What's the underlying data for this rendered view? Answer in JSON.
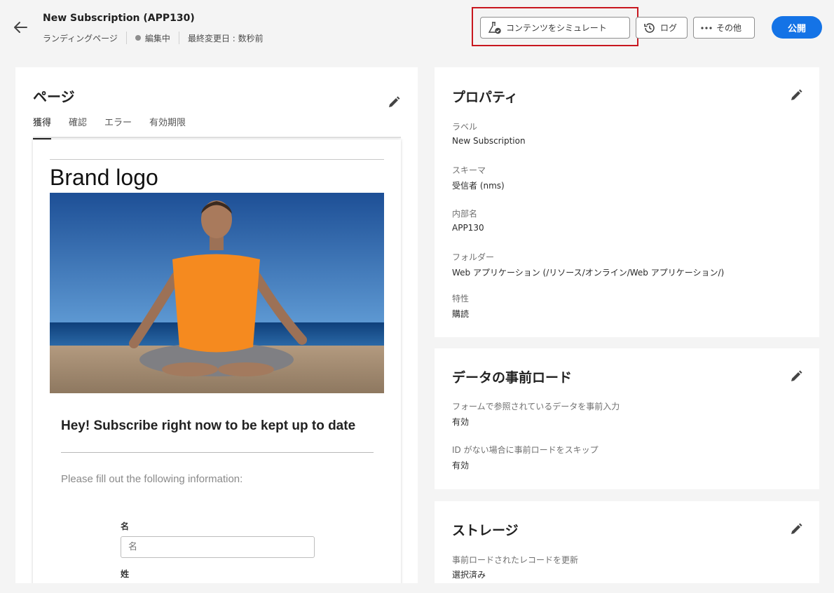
{
  "header": {
    "title": "New Subscription (APP130)",
    "type": "ランディングページ",
    "status": "編集中",
    "last_modified": "最終変更日 : 数秒前",
    "simulate_label": "コンテンツをシミュレート",
    "log_label": "ログ",
    "more_label": "その他",
    "publish_label": "公開"
  },
  "page_panel": {
    "title": "ページ",
    "tabs": [
      "獲得",
      "確認",
      "エラー",
      "有効期限"
    ],
    "active_tab": 0
  },
  "preview": {
    "brand_logo": "Brand logo",
    "headline": "Hey! Subscribe right now to be kept up to date",
    "instructions": "Please fill out the following information:",
    "first_name_label": "名",
    "first_name_placeholder": "名",
    "last_name_label": "姓"
  },
  "properties": {
    "title": "プロパティ",
    "fields": [
      {
        "label": "ラベル",
        "value": "New Subscription"
      },
      {
        "label": "スキーマ",
        "value": "受信者 (nms)"
      },
      {
        "label": "内部名",
        "value": "APP130"
      },
      {
        "label": "フォルダー",
        "value": "Web アプリケーション (/リソース/オンライン/Web アプリケーション/)"
      },
      {
        "label": "特性",
        "value": "購読"
      }
    ]
  },
  "preload": {
    "title": "データの事前ロード",
    "fields": [
      {
        "label": "フォームで参照されているデータを事前入力",
        "value": "有効"
      },
      {
        "label": "ID がない場合に事前ロードをスキップ",
        "value": "有効"
      }
    ]
  },
  "storage": {
    "title": "ストレージ",
    "fields": [
      {
        "label": "事前ロードされたレコードを更新",
        "value": "選択済み"
      }
    ]
  },
  "colors": {
    "accent": "#1473e6",
    "highlight": "#c8171f",
    "background": "#f4f4f4"
  }
}
